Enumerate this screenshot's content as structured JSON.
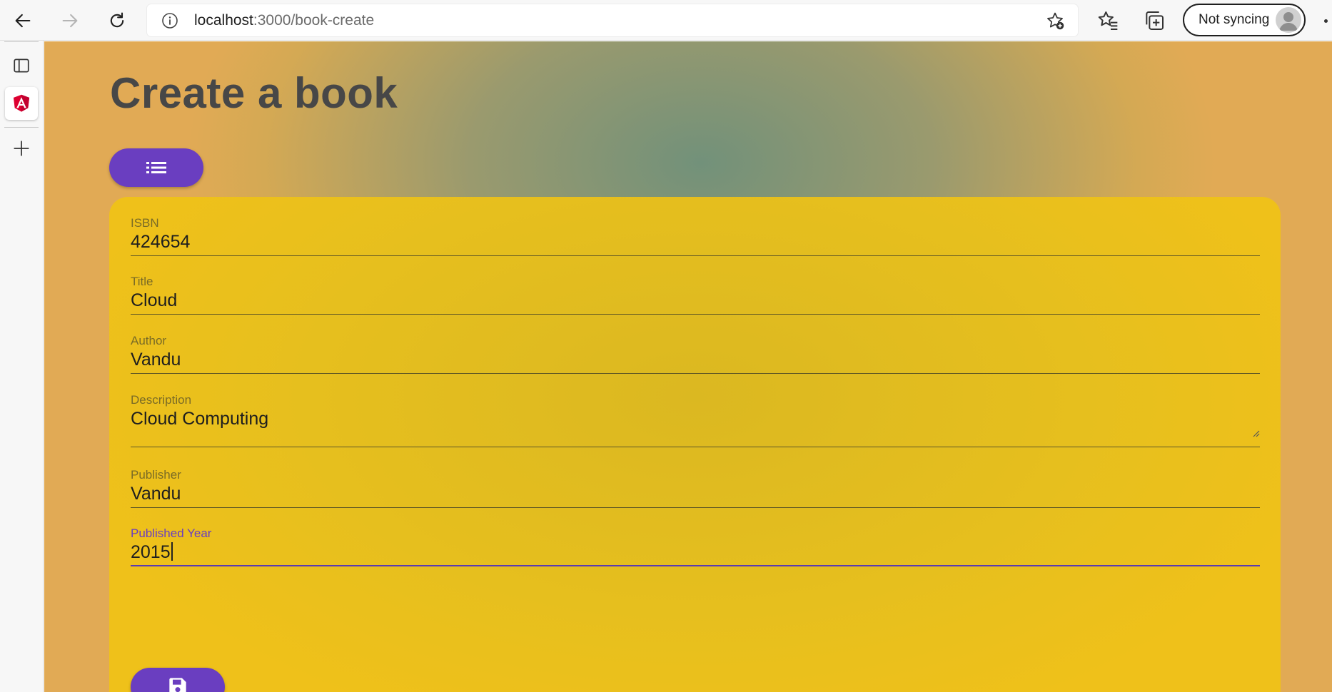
{
  "browser": {
    "url_host": "localhost",
    "url_path": ":3000/book-create",
    "sync_label": "Not syncing"
  },
  "page": {
    "title": "Create a book"
  },
  "form": {
    "fields": [
      {
        "label": "ISBN",
        "value": "424654"
      },
      {
        "label": "Title",
        "value": "Cloud"
      },
      {
        "label": "Author",
        "value": "Vandu"
      },
      {
        "label": "Description",
        "value": "Cloud Computing"
      },
      {
        "label": "Publisher",
        "value": "Vandu"
      },
      {
        "label": "Published Year",
        "value": "2015"
      }
    ]
  },
  "icons": {
    "list_button": "list-icon",
    "save_button": "save-icon",
    "side_tab": "angular-icon"
  },
  "colors": {
    "accent": "#6a3ec0",
    "card": "#e6bf1e",
    "title": "#474747"
  }
}
